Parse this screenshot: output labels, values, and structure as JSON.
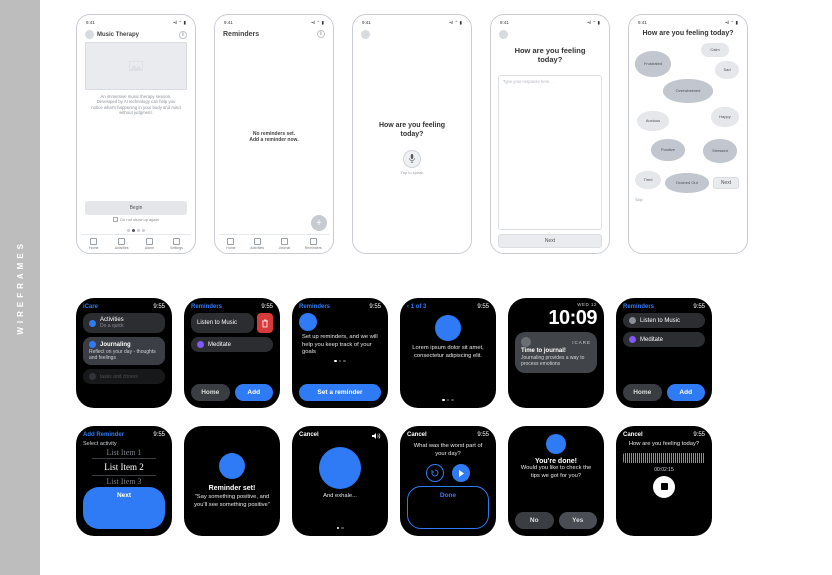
{
  "sidebar": {
    "label": "WIREFRAMES"
  },
  "phone_status": {
    "time": "9:41",
    "signal": "•ıl ⌃ ▮"
  },
  "phones": {
    "p1": {
      "title": "Music Therapy",
      "desc": "An immersive music therapy session. Developed by AI technology can help you notice what's happening in your body and mind without judgment.",
      "begin": "Begin",
      "dont_show": "Do not show up again",
      "tabs": [
        "Home",
        "Activities",
        "Alarm",
        "Settings"
      ]
    },
    "p2": {
      "title": "Reminders",
      "empty1": "No reminders set.",
      "empty2": "Add a reminder now.",
      "tabs": [
        "Home",
        "Activities",
        "Journal",
        "Reminders"
      ]
    },
    "p3": {
      "question": "How are you feeling today?",
      "mic_label": "Tap to speak"
    },
    "p4": {
      "question": "How are you feeling today?",
      "placeholder": "Type your response here...",
      "next": "Next"
    },
    "p5": {
      "question": "How are you feeling today?",
      "next": "Next",
      "skip": "Skip",
      "moods": [
        "Calm",
        "Frustrated",
        "Sad",
        "Overwhelmed",
        "Anxious",
        "Happy",
        "Positive",
        "Stressed",
        "Tired",
        "Drained Out"
      ]
    }
  },
  "colors": {
    "blue": "#2f7bf5",
    "purple": "#8257ff",
    "gray": "#8a8f98",
    "red": "#d63a3a"
  },
  "watch_time": "9:55",
  "row1": {
    "w1": {
      "title": "iCare",
      "act_label": "Activities",
      "act_sub": "Do a quick",
      "jr_label": "Journaling",
      "jr_sub": "Reflect on your day - thoughts and feelings",
      "extra_sub": "tasks and chores"
    },
    "w2": {
      "title": "Reminders",
      "items": [
        "Listen to Music",
        "Meditate"
      ],
      "home": "Home",
      "add": "Add"
    },
    "w3": {
      "title": "Reminders",
      "body": "Set up reminders, and we will help you keep track of your goals",
      "cta": "Set a reminder"
    },
    "w4": {
      "crumb": "1 of 3",
      "body": "Lorem ipsum dolor sit amet, consectetur adipiscing elit."
    },
    "w5": {
      "dow": "WED 12",
      "time": "10:09",
      "app": "ICARE",
      "nt": "Time to journal!",
      "nb": "Journaling provides a way to process emotions"
    },
    "w6": {
      "title": "Reminders",
      "items": [
        "Listen to Music",
        "Meditate"
      ],
      "home": "Home",
      "add": "Add"
    }
  },
  "row2": {
    "w7": {
      "title": "Add Reminder",
      "hint": "Select activity",
      "picker": [
        "List Item 1",
        "List Item 2",
        "List Item 3"
      ],
      "next": "Next"
    },
    "w8": {
      "title": "Reminder set!",
      "body": "\"Say something positive, and you'll see something positive\""
    },
    "w9": {
      "cancel": "Cancel",
      "caption": "And exhale..."
    },
    "w10": {
      "cancel": "Cancel",
      "q": "What was the worst part of your day?",
      "done": "Done"
    },
    "w11": {
      "title": "You're done!",
      "body": "Would you like to check the tips we got for you?",
      "no": "No",
      "yes": "Yes"
    },
    "w12": {
      "cancel": "Cancel",
      "q": "How are you feeling today?",
      "timer": "00:02:15"
    }
  }
}
